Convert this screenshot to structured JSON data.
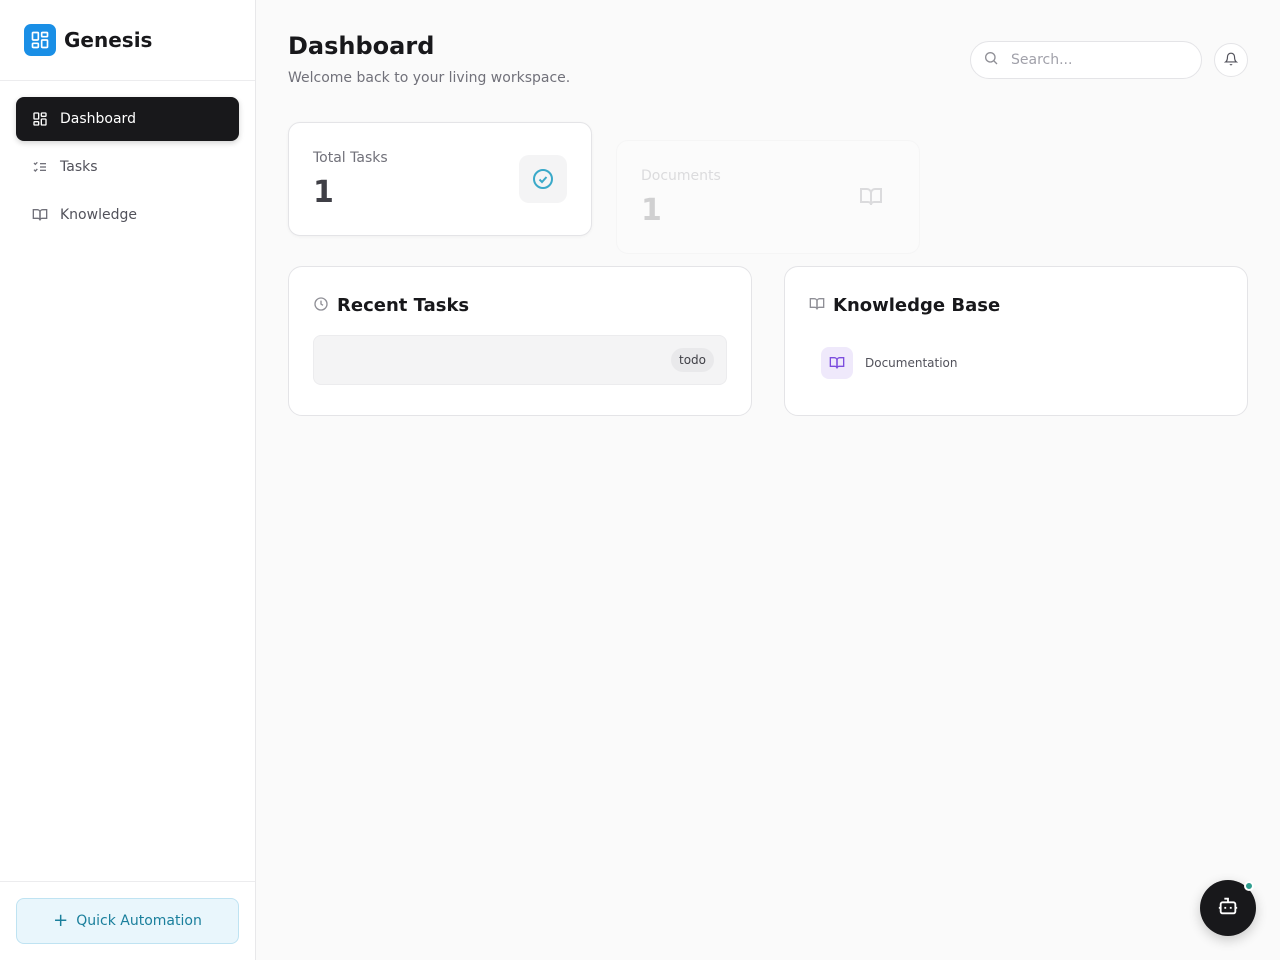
{
  "app": {
    "name": "Genesis",
    "brand_color": "#1a8fe6"
  },
  "sidebar": {
    "items": [
      {
        "label": "Dashboard",
        "icon": "layout-grid-icon",
        "active": true
      },
      {
        "label": "Tasks",
        "icon": "list-checks-icon",
        "active": false
      },
      {
        "label": "Knowledge",
        "icon": "book-open-icon",
        "active": false
      }
    ],
    "quick_action": {
      "label": "Quick Automation",
      "icon": "plus-icon"
    }
  },
  "header": {
    "title": "Dashboard",
    "subtitle": "Welcome back to your living workspace.",
    "search": {
      "placeholder": "Search...",
      "value": ""
    },
    "notification_icon": "bell-icon"
  },
  "stats": [
    {
      "label": "Total Tasks",
      "value": "1",
      "icon": "check-circle-icon",
      "icon_color": "#3aa9c9"
    },
    {
      "label": "Documents",
      "value": "1",
      "icon": "book-open-icon",
      "icon_color": "#71717a"
    }
  ],
  "recent_tasks": {
    "title": "Recent Tasks",
    "icon": "clock-icon",
    "items": [
      {
        "title": "",
        "status": "todo"
      }
    ]
  },
  "knowledge_base": {
    "title": "Knowledge Base",
    "icon": "book-open-icon",
    "items": [
      {
        "label": "Documentation",
        "icon": "book-open-icon",
        "icon_color": "#7c4dde"
      }
    ]
  },
  "assistant": {
    "icon": "bot-icon",
    "status_color": "#2f9e8f"
  }
}
